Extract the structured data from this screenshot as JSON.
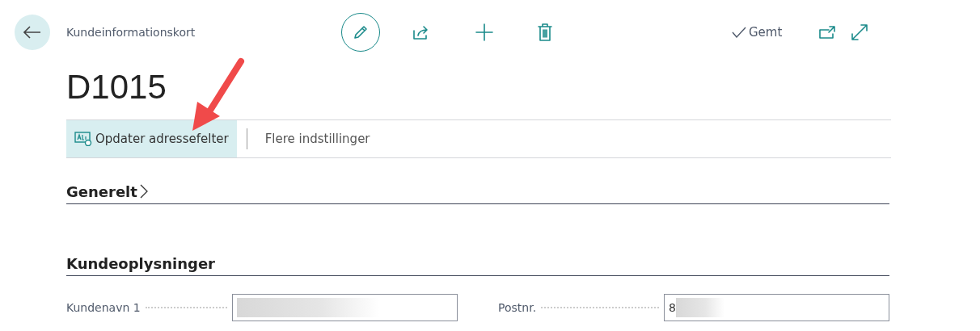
{
  "header": {
    "title": "Kundeinformationskort",
    "saved_status": "Gemt"
  },
  "record": {
    "title": "D1015"
  },
  "action_bar": [
    {
      "label": "Opdater adressefelter",
      "selected": true,
      "kind": "icon"
    },
    {
      "label": "Flere indstillinger",
      "selected": false,
      "kind": "text"
    }
  ],
  "sections": [
    {
      "title": "Generelt",
      "expanded": false
    },
    {
      "title": "Kundeoplysninger",
      "expanded": true,
      "fields": [
        {
          "label": "Kundenavn 1",
          "redacted": true
        },
        {
          "label": "Postnr.",
          "value": "8",
          "redacted": true
        }
      ]
    }
  ]
}
